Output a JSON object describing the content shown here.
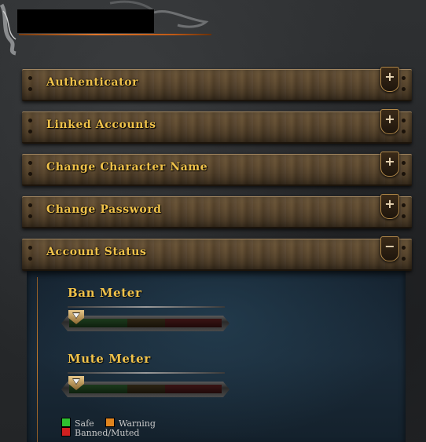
{
  "accordion": {
    "items": [
      {
        "label": "Authenticator",
        "toggle": "+"
      },
      {
        "label": "Linked Accounts",
        "toggle": "+"
      },
      {
        "label": "Change Character Name",
        "toggle": "+"
      },
      {
        "label": "Change Password",
        "toggle": "+"
      },
      {
        "label": "Account Status",
        "toggle": "−"
      }
    ]
  },
  "account_status": {
    "ban_meter": {
      "title": "Ban Meter",
      "level": 0.0
    },
    "mute_meter": {
      "title": "Mute Meter",
      "level": 0.0
    },
    "legend": {
      "safe": "Safe",
      "warning": "Warning",
      "banned": "Banned/Muted"
    }
  },
  "colors": {
    "accent_gold": "#f0c24a",
    "safe": "#2fbf2f",
    "warning": "#e0841e",
    "banned": "#d02020"
  },
  "icons": {
    "expand": "plus-icon",
    "collapse": "minus-icon",
    "pointer": "triangle-down-icon"
  }
}
